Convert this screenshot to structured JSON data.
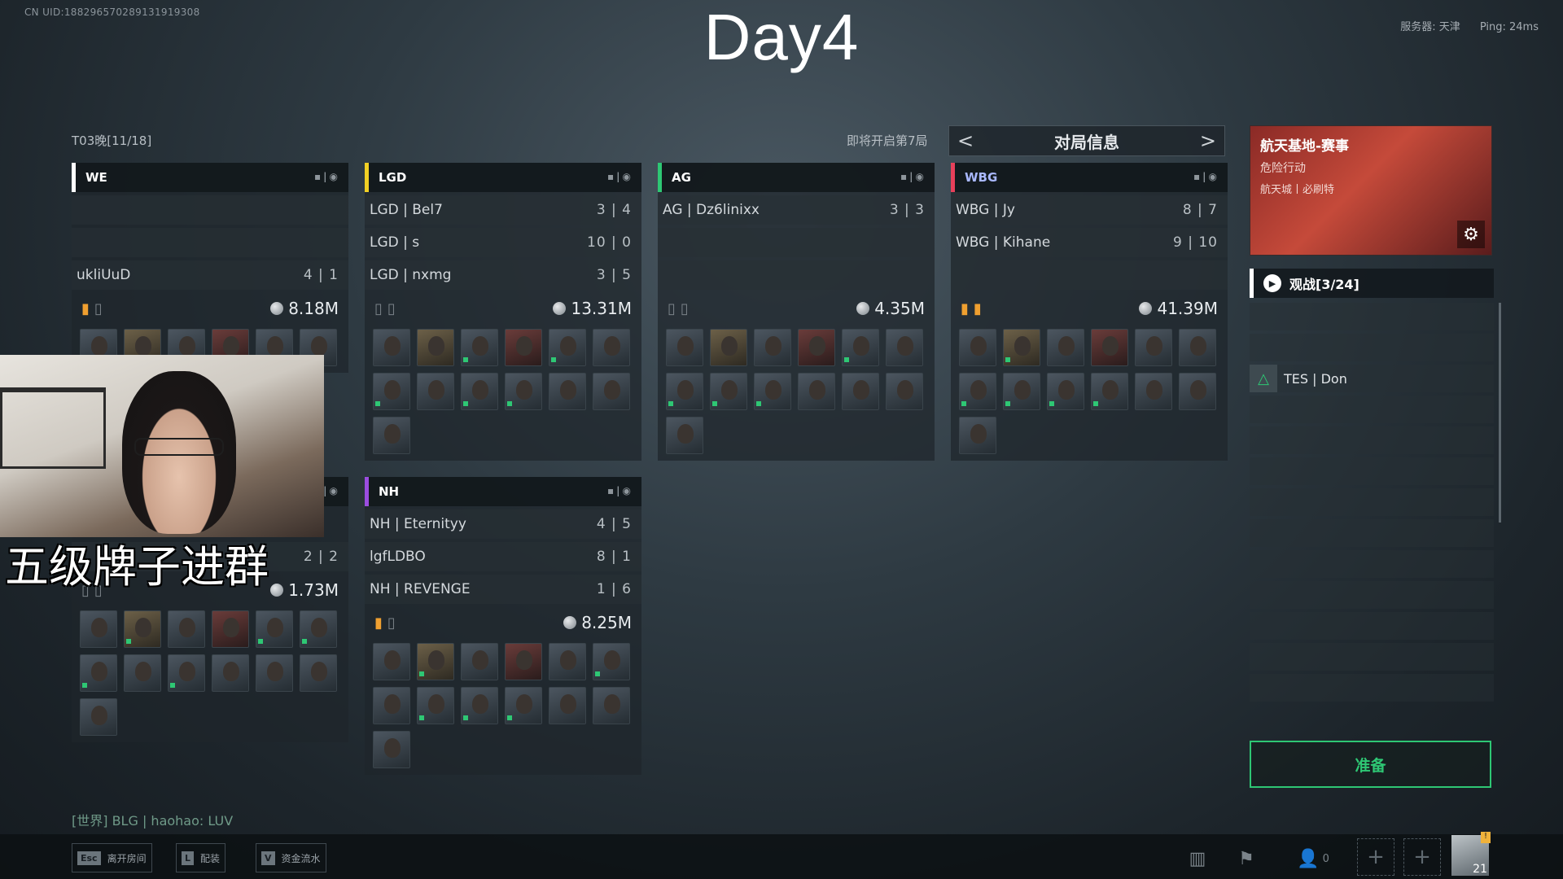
{
  "uid": "CN UID:1882965702891319193​08",
  "stream_title": "Day4",
  "server": {
    "label": "服务器: 天津",
    "ping": "Ping: 24ms"
  },
  "room_name": "T03晚[11/18]",
  "next_round": "即将开启第7局",
  "info_panel": {
    "title": "对局信息",
    "prev": "<",
    "next": ">"
  },
  "teams": [
    {
      "name": "WE",
      "color": "#ffffff",
      "players": [
        {
          "name": "",
          "score": ""
        },
        {
          "name": "",
          "score": ""
        },
        {
          "name": "ukliUuD",
          "score": "4 | 1"
        }
      ],
      "medals": [
        true,
        false
      ],
      "money": "8.18M"
    },
    {
      "name": "LGD",
      "color": "#f2d024",
      "players": [
        {
          "name": "LGD | Bel7",
          "score": "3 | 4"
        },
        {
          "name": "LGD | s",
          "score": "10 | 0"
        },
        {
          "name": "LGD | nxmg",
          "score": "3 | 5"
        }
      ],
      "medals": [
        false,
        false
      ],
      "money": "13.31M"
    },
    {
      "name": "AG",
      "color": "#2ec774",
      "players": [
        {
          "name": "AG | Dz6linixx",
          "score": "3 | 3"
        },
        {
          "name": "",
          "score": ""
        },
        {
          "name": "",
          "score": ""
        }
      ],
      "medals": [
        false,
        false
      ],
      "money": "4.35M"
    },
    {
      "name": "WBG",
      "color": "#e8405a",
      "players": [
        {
          "name": "WBG | Jy",
          "score": "8 | 7"
        },
        {
          "name": "WBG | Kihane",
          "score": "9 | 10"
        },
        {
          "name": "",
          "score": ""
        }
      ],
      "medals": [
        true,
        true
      ],
      "money": "41.39M"
    },
    {
      "name": "",
      "color": "#ffffff",
      "players": [
        {
          "name": "",
          "score": "2 | 2"
        }
      ],
      "medals": [
        false,
        false
      ],
      "money": "1.73M"
    },
    {
      "name": "NH",
      "color": "#9b4de0",
      "players": [
        {
          "name": "NH | Eternityy",
          "score": "4 | 5"
        },
        {
          "name": "lgfLDBO",
          "score": "8 | 1"
        },
        {
          "name": "NH | REVENGE",
          "score": "1 | 6"
        }
      ],
      "medals": [
        true,
        false
      ],
      "money": "8.25M"
    }
  ],
  "map_card": {
    "title": "航天基地-赛事",
    "mode": "危险行动",
    "sub": "航天城丨必刷特"
  },
  "spectators": {
    "label": "观战[3/24]",
    "list": [
      "TES | Don"
    ]
  },
  "ready_button": "准备",
  "chat_line": "[世界] BLG | haohao: LUV",
  "hotkeys": [
    {
      "key": "Esc",
      "label": "离开房间"
    },
    {
      "key": "L",
      "label": "配装"
    },
    {
      "key": "V",
      "label": "资金流水"
    }
  ],
  "bottom_icons": {
    "friends_count": "0",
    "level": "21"
  },
  "stream_overlay": "五级牌子进群"
}
